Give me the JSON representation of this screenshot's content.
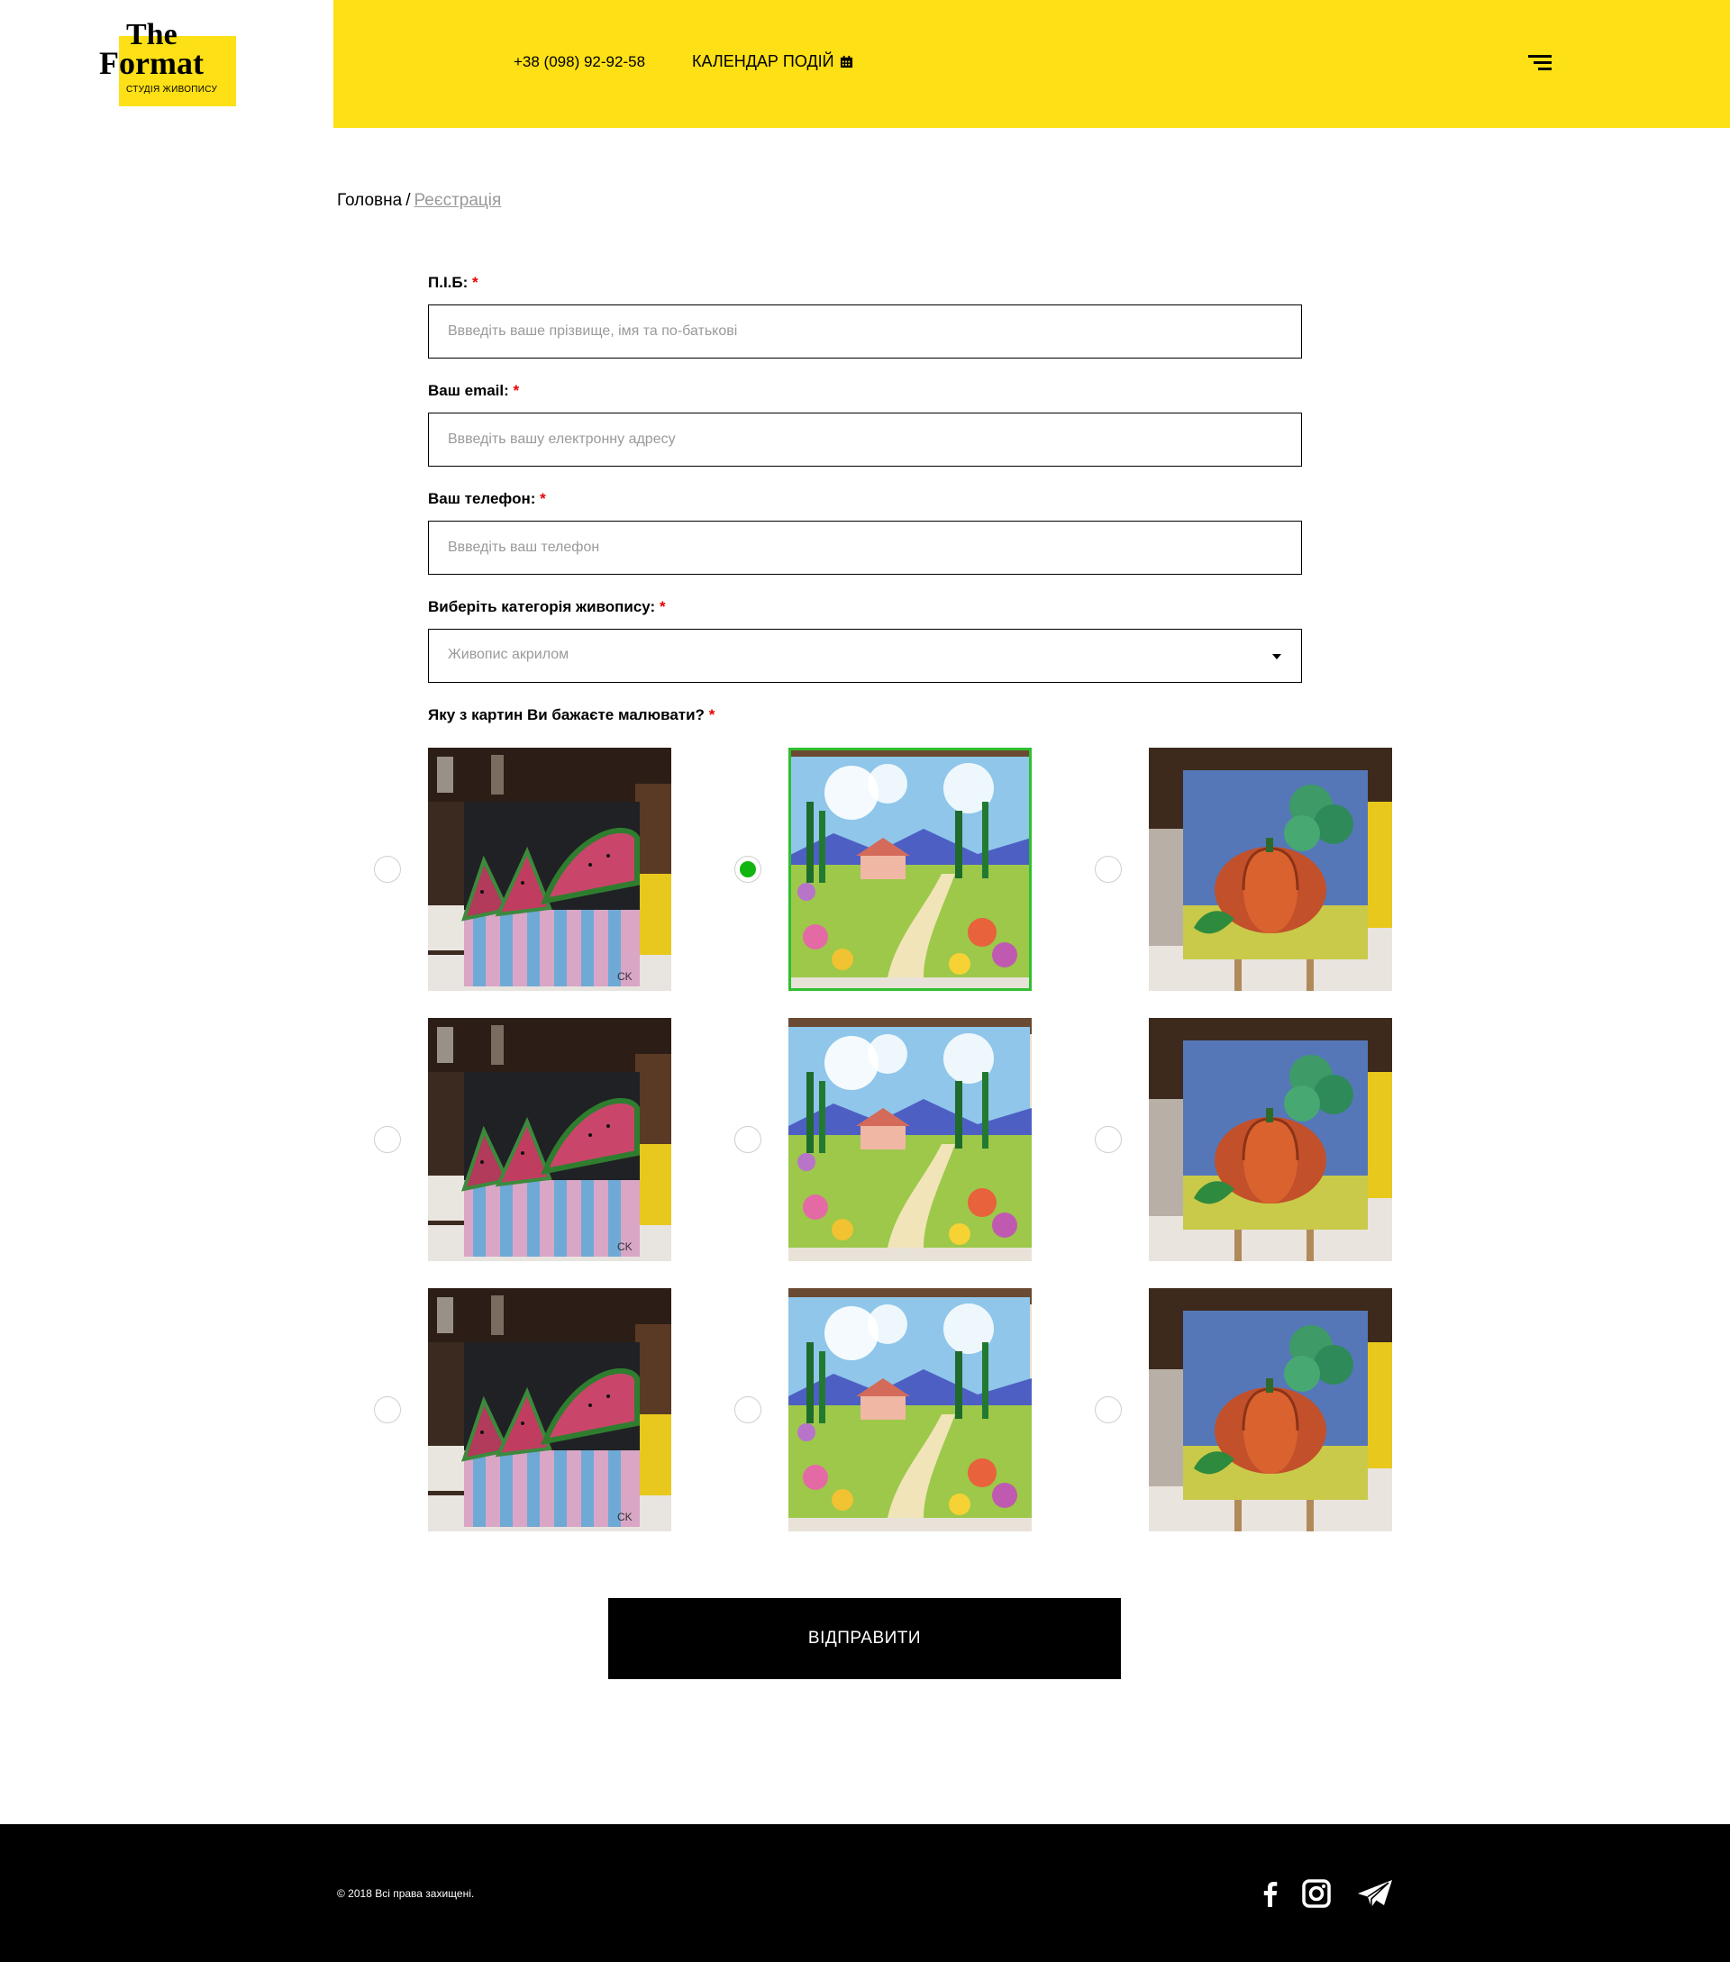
{
  "header": {
    "logo": {
      "line1": "The",
      "line2": "Format",
      "tagline": "СТУДІЯ ЖИВОПИСУ",
      "icon": "logo"
    },
    "phone": "+38 (098) 92-92-58",
    "calendar_label": "КАЛЕНДАР ПОДІЙ",
    "calendar_icon": "calendar-icon",
    "menu_icon": "hamburger-menu-icon",
    "accent_color": "#fde015"
  },
  "breadcrumb": {
    "home": "Головна",
    "separator": "/",
    "current": "Реєстрація"
  },
  "form": {
    "name": {
      "label": "П.І.Б:",
      "required": "*",
      "placeholder": "Ввведіть ваше прізвище, імя та по-батькові",
      "value": ""
    },
    "email": {
      "label": "Ваш email:",
      "required": "*",
      "placeholder": "Ввведіть вашу електронну адресу",
      "value": ""
    },
    "phone": {
      "label": "Ваш телефон:",
      "required": "*",
      "placeholder": "Ввведіть ваш телефон",
      "value": ""
    },
    "category": {
      "label": "Виберіть категорія живопису:",
      "required": "*",
      "selected": "Живопис акрилом"
    },
    "painting": {
      "label": "Яку з картин Ви бажаєте малювати?",
      "required": "*",
      "selected_color": "#10b510",
      "options": [
        {
          "subject": "watermelons",
          "checked": false
        },
        {
          "subject": "landscape",
          "checked": true
        },
        {
          "subject": "pumpkin",
          "checked": false
        },
        {
          "subject": "watermelons",
          "checked": false
        },
        {
          "subject": "landscape",
          "checked": false
        },
        {
          "subject": "pumpkin",
          "checked": false
        },
        {
          "subject": "watermelons",
          "checked": false
        },
        {
          "subject": "landscape",
          "checked": false
        },
        {
          "subject": "pumpkin",
          "checked": false
        }
      ]
    },
    "submit_label": "ВІДПРАВИТИ"
  },
  "footer": {
    "copyright": "© 2018 Всі права захищені.",
    "social_icons": [
      "facebook-icon",
      "instagram-icon",
      "telegram-icon"
    ]
  }
}
